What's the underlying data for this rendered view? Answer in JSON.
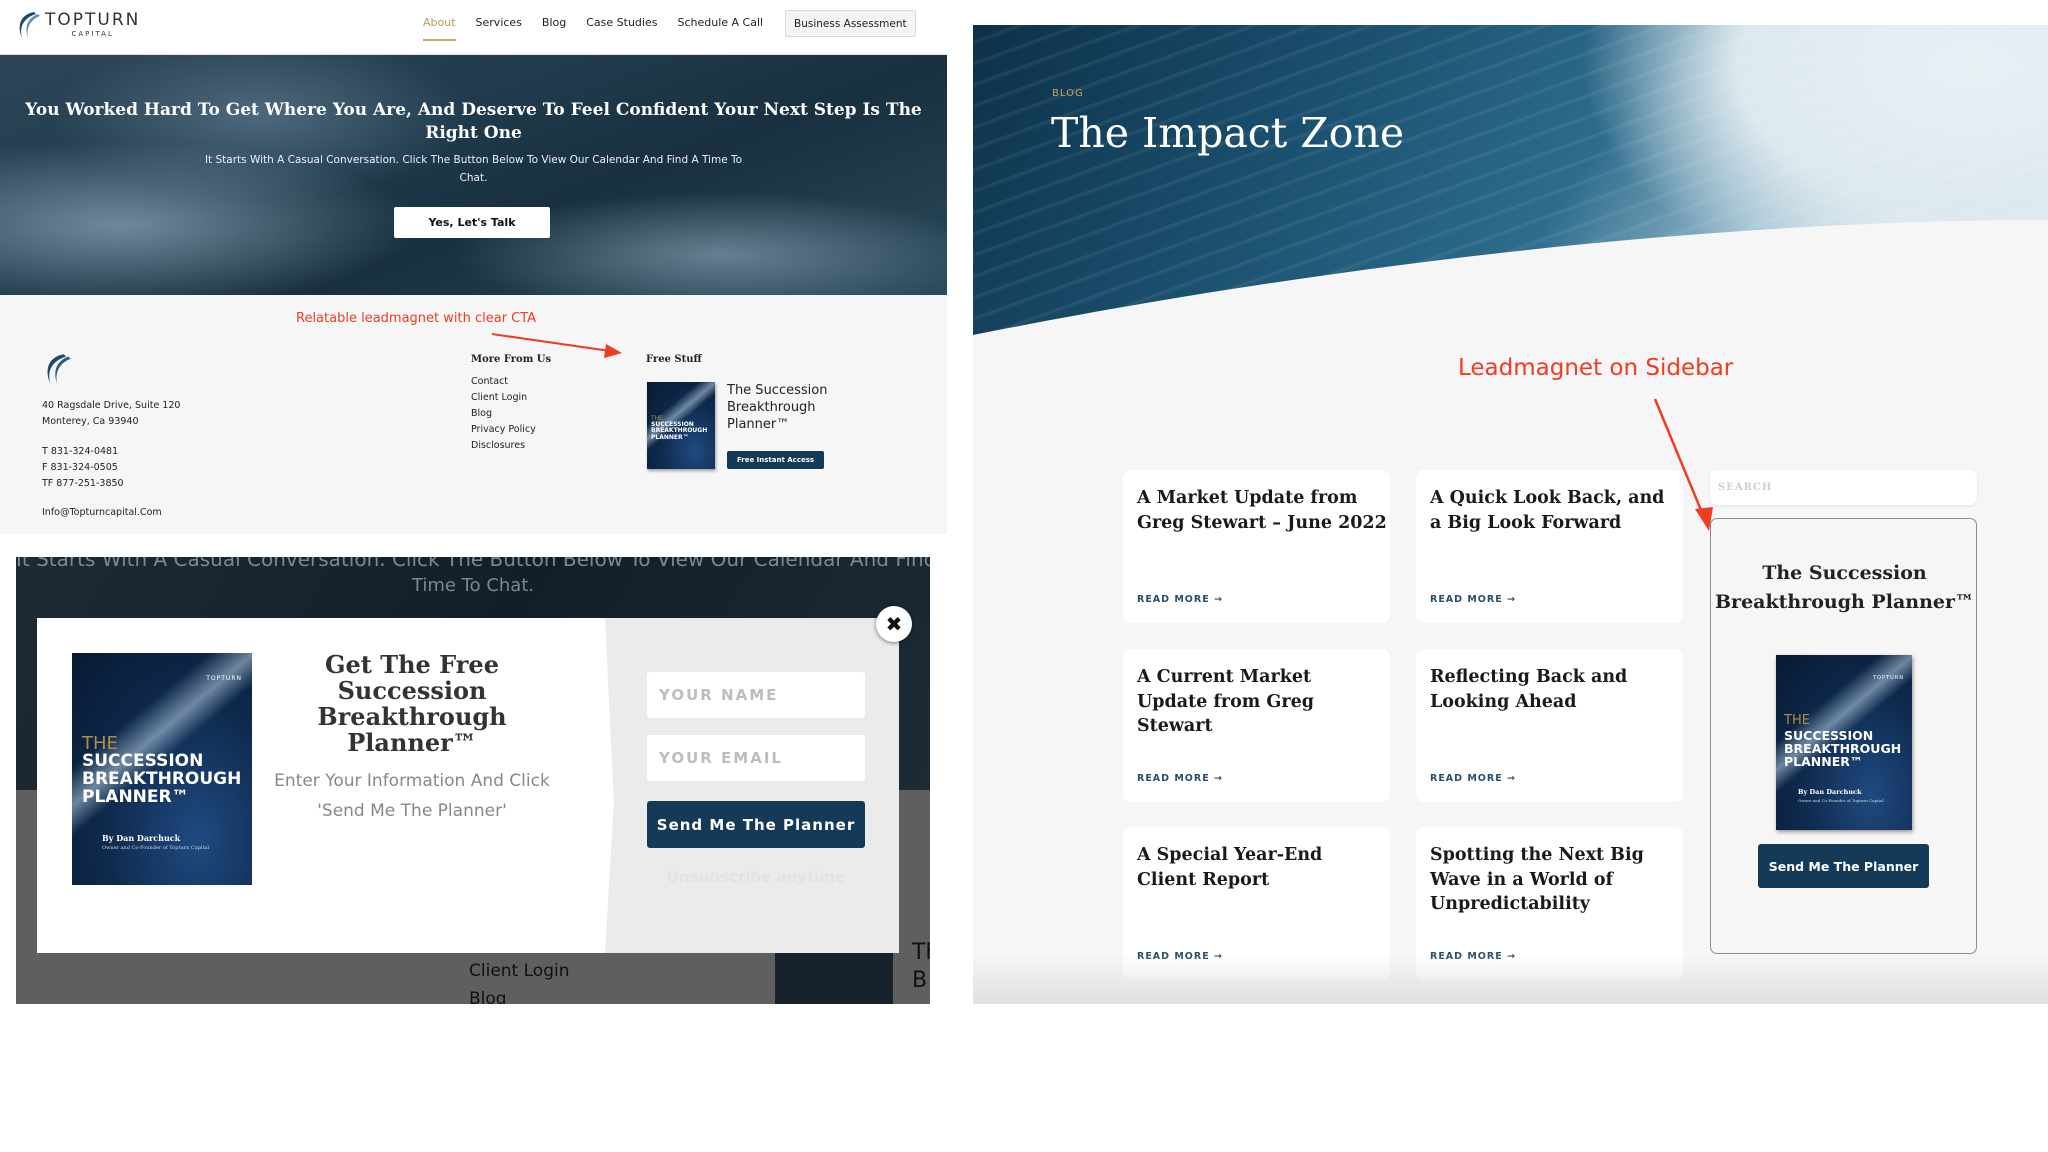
{
  "site": {
    "logo_main": "TOPTURN",
    "logo_sub": "CAPITAL",
    "nav": [
      {
        "label": "About",
        "active": true
      },
      {
        "label": "Services",
        "active": false
      },
      {
        "label": "Blog",
        "active": false
      },
      {
        "label": "Case Studies",
        "active": false
      },
      {
        "label": "Schedule A Call",
        "active": false
      }
    ],
    "nav_cta": "Business Assessment",
    "hero": {
      "title": "You Worked Hard To Get Where You Are, And Deserve To Feel Confident Your Next Step Is The Right One",
      "subtitle": "It Starts With A Casual Conversation. Click The Button Below To View Our Calendar And Find A Time To Chat.",
      "button": "Yes, Let's Talk"
    },
    "footer": {
      "address_line1": "40 Ragsdale Drive, Suite 120",
      "address_line2": "Monterey, Ca 93940",
      "phone_t": "T 831-324-0481",
      "phone_f": "F 831-324-0505",
      "phone_tf": "TF 877-251-3850",
      "email": "Info@Topturncapital.Com",
      "more_title": "More From Us",
      "more_links": [
        "Contact",
        "Client Login",
        "Blog",
        "Privacy Policy",
        "Disclosures"
      ],
      "free_title": "Free Stuff",
      "free_book_title": "The Succession Breakthrough Planner™",
      "free_button": "Free Instant Access"
    }
  },
  "annotations": {
    "footer_note": "Relatable leadmagnet with clear CTA",
    "sidebar_note": "Leadmagnet on Sidebar",
    "accent_color": "#f03c22"
  },
  "book_cover": {
    "the": "THE",
    "line1": "SUCCESSION",
    "line2": "BREAKTHROUGH",
    "line3": "PLANNER™",
    "author": "By Dan Darchuck",
    "role": "Owner and Co-Founder of Topturn Capital",
    "brand": "TOPTURN"
  },
  "popup": {
    "bg_text_line1": "It Starts With A Casual Conversation. Click The Button Below To View Our Calendar And Find A",
    "bg_text_line2": "Time To Chat.",
    "bg_links": [
      "Client Login",
      "Blog"
    ],
    "bg_book_text": "Th\nB",
    "title": "Get The Free Succession Breakthrough Planner™",
    "subtitle": "Enter Your Information And Click 'Send Me The Planner'",
    "name_placeholder": "YOUR NAME",
    "name_value": "",
    "email_placeholder": "YOUR EMAIL",
    "email_value": "",
    "submit": "Send Me The Planner",
    "unsubscribe": "Unsubscribe anytime",
    "close_icon": "✖"
  },
  "blog": {
    "label": "BLOG",
    "title": "The Impact Zone",
    "posts": [
      {
        "title": "A Market Update from Greg Stewart – June 2022",
        "more": "READ MORE →"
      },
      {
        "title": "A Quick Look Back, and a Big Look Forward",
        "more": "READ MORE →"
      },
      {
        "title": "A Current Market Update from Greg Stewart",
        "more": "READ MORE →"
      },
      {
        "title": "Reflecting Back and Looking Ahead",
        "more": "READ MORE →"
      },
      {
        "title": "A Special Year-End Client Report",
        "more": "READ MORE →"
      },
      {
        "title": "Spotting the Next Big Wave in a World of Unpredictability",
        "more": "READ MORE →"
      }
    ],
    "search_placeholder": "SEARCH",
    "search_value": "",
    "sidebar_title": "The Succession Breakthrough Planner™",
    "sidebar_button": "Send Me The Planner"
  },
  "colors": {
    "brand_navy": "#143a57",
    "gold": "#c8a55a"
  }
}
